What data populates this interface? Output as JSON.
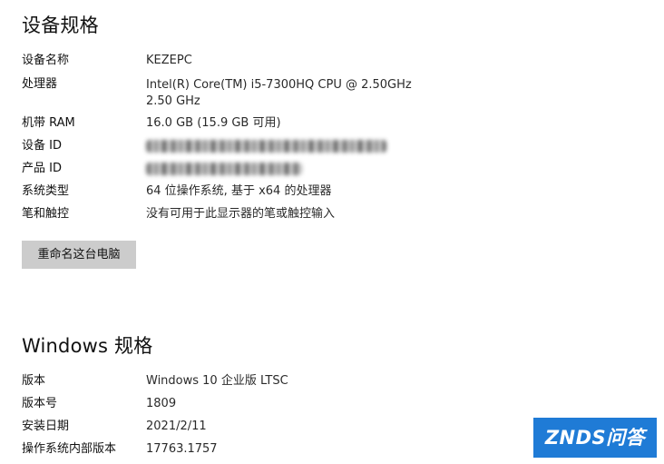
{
  "device_specs": {
    "heading": "设备规格",
    "rows": [
      {
        "label": "设备名称",
        "value": "KEZEPC"
      },
      {
        "label": "处理器",
        "value": "Intel(R) Core(TM) i5-7300HQ CPU @ 2.50GHz",
        "value_line2": "2.50 GHz"
      },
      {
        "label": "机带 RAM",
        "value": "16.0 GB (15.9 GB 可用)"
      },
      {
        "label": "设备 ID",
        "value": ""
      },
      {
        "label": "产品 ID",
        "value": ""
      },
      {
        "label": "系统类型",
        "value": "64 位操作系统, 基于 x64 的处理器"
      },
      {
        "label": "笔和触控",
        "value": "没有可用于此显示器的笔或触控输入"
      }
    ],
    "rename_button": "重命名这台电脑"
  },
  "windows_specs": {
    "heading": "Windows 规格",
    "rows": [
      {
        "label": "版本",
        "value": "Windows 10 企业版 LTSC"
      },
      {
        "label": "版本号",
        "value": "1809"
      },
      {
        "label": "安装日期",
        "value": "2021/2/11"
      },
      {
        "label": "操作系统内部版本",
        "value": "17763.1757"
      }
    ]
  },
  "watermark": {
    "text": "ZNDS问答",
    "color": "#1f7bd6"
  }
}
